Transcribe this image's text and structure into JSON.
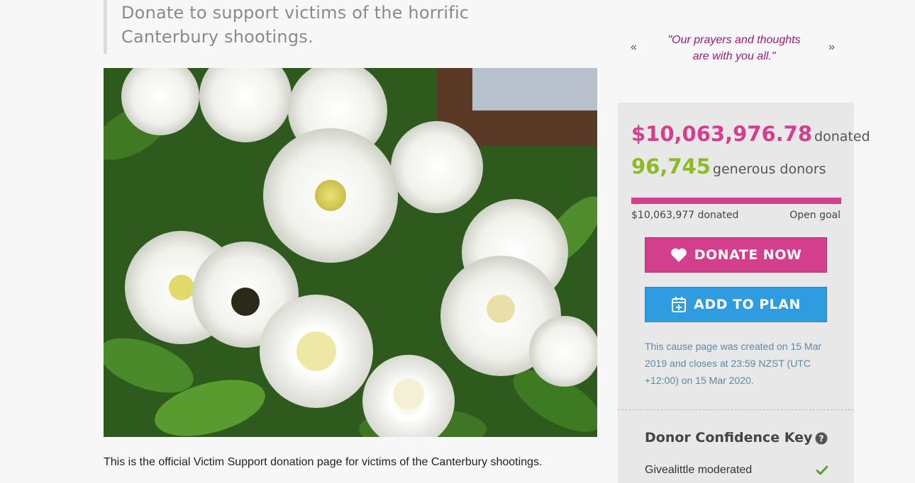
{
  "page": {
    "title": "Donate to support victims of the horrific Canterbury shootings.",
    "description": "This is the official Victim Support donation page for victims of the Canterbury shootings."
  },
  "hero_image": {
    "subject": "white flowers bouquet"
  },
  "quote": {
    "prev_label": "«",
    "next_label": "»",
    "text": "\"Our prayers and thoughts are with you all.\""
  },
  "stats": {
    "amount": "$10,063,976.78",
    "amount_suffix": "donated",
    "donors": "96,745",
    "donors_suffix": "generous donors",
    "progress_left": "$10,063,977 donated",
    "progress_right": "Open goal",
    "progress_fraction": 1.0
  },
  "buttons": {
    "donate_label": "DONATE NOW",
    "donate_icon": "heart-icon",
    "plan_label": "ADD TO PLAN",
    "plan_icon": "calendar-plus-icon"
  },
  "created_note": "This cause page was created on 15 Mar 2019 and closes at 23:59 NZST (UTC +12:00) on 15 Mar 2020.",
  "confidence": {
    "title": "Donor Confidence Key",
    "help_icon": "question-circle-icon",
    "items": [
      {
        "label": "Givealittle moderated",
        "icon": "check-icon"
      }
    ]
  },
  "colors": {
    "accent_pink": "#d43f8d",
    "accent_green": "#8cba28",
    "accent_blue": "#2f9be0",
    "quote_color": "#a01a78"
  }
}
